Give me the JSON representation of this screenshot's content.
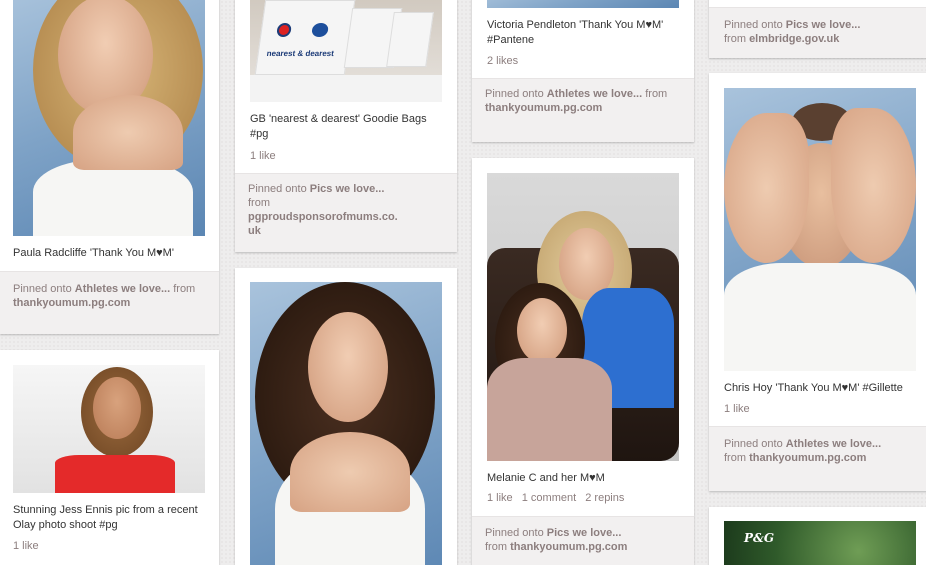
{
  "pins": {
    "paula": {
      "description": "Paula Radcliffe 'Thank You M♥M'",
      "pinned_prefix": "Pinned onto",
      "board": "Athletes we love...",
      "from_prefix": "from",
      "source": "thankyoumum.pg.com"
    },
    "jess": {
      "description": "Stunning Jess Ennis pic from a recent Olay photo shoot #pg",
      "likes": "1 like"
    },
    "gb_bags": {
      "description": "GB 'nearest & dearest' Goodie Bags #pg",
      "likes": "1 like",
      "pinned_prefix": "Pinned onto",
      "board": "Pics we love...",
      "from_prefix": "from",
      "source": "pgproudsponsorofmums.co.uk",
      "bag_text": "nearest & dearest"
    },
    "victoria": {
      "description": "Victoria Pendleton 'Thank You M♥M' #Pantene",
      "likes": "2 likes",
      "pinned_prefix": "Pinned onto",
      "board": "Athletes we love...",
      "from_prefix": "from",
      "source": "thankyoumum.pg.com"
    },
    "melanie": {
      "description": "Melanie C and her M♥M",
      "likes": "1 like",
      "comments": "1 comment",
      "repins": "2 repins",
      "pinned_prefix": "Pinned onto",
      "board": "Pics we love...",
      "from_prefix": "from",
      "source": "thankyoumum.pg.com"
    },
    "elmbridge": {
      "pinned_prefix": "Pinned onto",
      "board": "Pics we love...",
      "from_prefix": "from",
      "source": "elmbridge.gov.uk"
    },
    "chris": {
      "description": "Chris Hoy 'Thank You M♥M' #Gillette",
      "likes": "1 like",
      "pinned_prefix": "Pinned onto",
      "board": "Athletes we love...",
      "from_prefix": "from",
      "source": "thankyoumum.pg.com"
    },
    "pg_ad": {
      "logo_text": "P&G"
    }
  }
}
